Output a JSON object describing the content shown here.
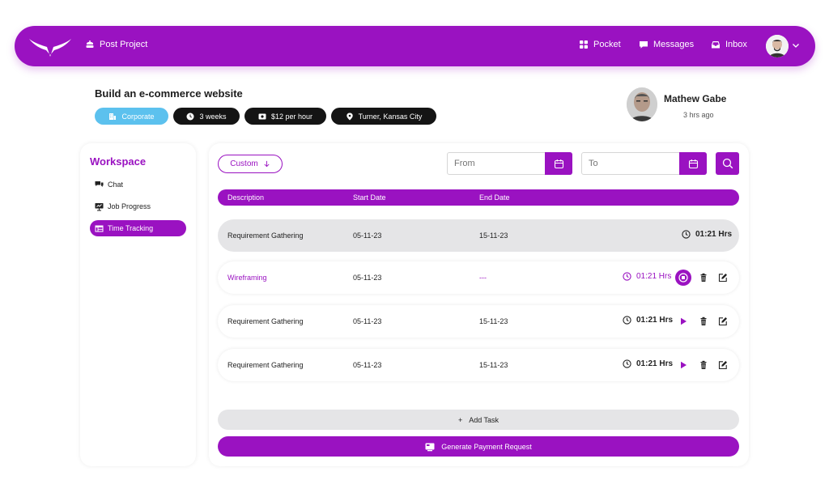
{
  "nav": {
    "post_project": "Post Project",
    "pocket": "Pocket",
    "messages": "Messages",
    "inbox": "Inbox"
  },
  "project": {
    "title": "Build an e-commerce website",
    "tags": {
      "category": "Corporate",
      "duration": "3 weeks",
      "rate": "$12 per hour",
      "location": "Turner, Kansas City"
    }
  },
  "client": {
    "name": "Mathew Gabe",
    "posted": "3 hrs ago"
  },
  "sidebar": {
    "title": "Workspace",
    "items": [
      {
        "label": "Chat"
      },
      {
        "label": "Job Progress"
      },
      {
        "label": "Time Tracking",
        "active": true
      }
    ]
  },
  "filters": {
    "custom_label": "Custom",
    "from_placeholder": "From",
    "to_placeholder": "To"
  },
  "table": {
    "headers": [
      "Description",
      "Start Date",
      "End Date"
    ],
    "rows": [
      {
        "description": "Requirement Gathering",
        "start": "05-11-23",
        "end": "15-11-23",
        "duration": "01:21 Hrs"
      },
      {
        "description": "Wireframing",
        "start": "05-11-23",
        "end": "---",
        "duration": "01:21 Hrs"
      },
      {
        "description": "Requirement Gathering",
        "start": "05-11-23",
        "end": "15-11-23",
        "duration": "01:21 Hrs"
      },
      {
        "description": "Requirement Gathering",
        "start": "05-11-23",
        "end": "15-11-23",
        "duration": "01:21 Hrs"
      }
    ]
  },
  "actions": {
    "add_task": "Add Task",
    "add_symbol": "+",
    "generate_payment": "Generate Payment Request"
  },
  "theme": {
    "accent": "#9a12c1",
    "corporate_tag": "#5cc1ee"
  }
}
